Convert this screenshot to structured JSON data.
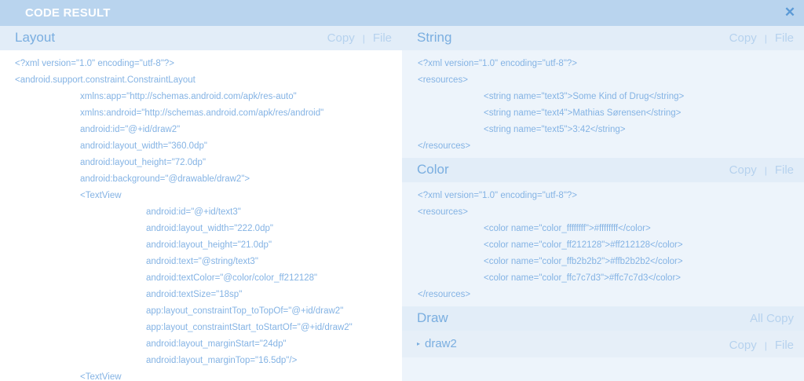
{
  "window": {
    "title": "CODE RESULT",
    "close_glyph": "✕"
  },
  "layout": {
    "title": "Layout",
    "copy": "Copy",
    "sep": "|",
    "file": "File",
    "lines": [
      "<?xml version=\"1.0\" encoding=\"utf-8\"?>",
      "<android.support.constraint.ConstraintLayout",
      "xmlns:app=\"http://schemas.android.com/apk/res-auto\"",
      "xmlns:android=\"http://schemas.android.com/apk/res/android\"",
      "android:id=\"@+id/draw2\"",
      "android:layout_width=\"360.0dp\"",
      "android:layout_height=\"72.0dp\"",
      "android:background=\"@drawable/draw2\">",
      "<TextView",
      "android:id=\"@+id/text3\"",
      "android:layout_width=\"222.0dp\"",
      "android:layout_height=\"21.0dp\"",
      "android:text=\"@string/text3\"",
      "android:textColor=\"@color/color_ff212128\"",
      "android:textSize=\"18sp\"",
      "app:layout_constraintTop_toTopOf=\"@+id/draw2\"",
      "app:layout_constraintStart_toStartOf=\"@+id/draw2\"",
      "android:layout_marginStart=\"24dp\"",
      "android:layout_marginTop=\"16.5dp\"/>",
      "<TextView"
    ]
  },
  "string": {
    "title": "String",
    "copy": "Copy",
    "sep": "|",
    "file": "File",
    "lines": [
      "<?xml version=\"1.0\" encoding=\"utf-8\"?>",
      "<resources>",
      "<string name=\"text3\">Some Kind of Drug</string>",
      "<string name=\"text4\">Mathias Sørensen</string>",
      "<string name=\"text5\">3:42</string>",
      "</resources>"
    ]
  },
  "color": {
    "title": "Color",
    "copy": "Copy",
    "sep": "|",
    "file": "File",
    "lines": [
      "<?xml version=\"1.0\" encoding=\"utf-8\"?>",
      "<resources>",
      "<color name=\"color_ffffffff\">#ffffffff</color>",
      "<color name=\"color_ff212128\">#ff212128</color>",
      "<color name=\"color_ffb2b2b2\">#ffb2b2b2</color>",
      "<color name=\"color_ffc7c7d3\">#ffc7c7d3</color>",
      "</resources>"
    ]
  },
  "draw": {
    "title": "Draw",
    "all_copy": "All Copy",
    "items": [
      {
        "name": "draw2",
        "copy": "Copy",
        "sep": "|",
        "file": "File",
        "expand_glyph": "▸"
      }
    ]
  },
  "colors": {
    "titlebar": "#b9d4ee",
    "accent": "#7aaee0",
    "muted": "#b6d2ee",
    "code": "#84b3e4",
    "close": "#5b9ad6"
  }
}
